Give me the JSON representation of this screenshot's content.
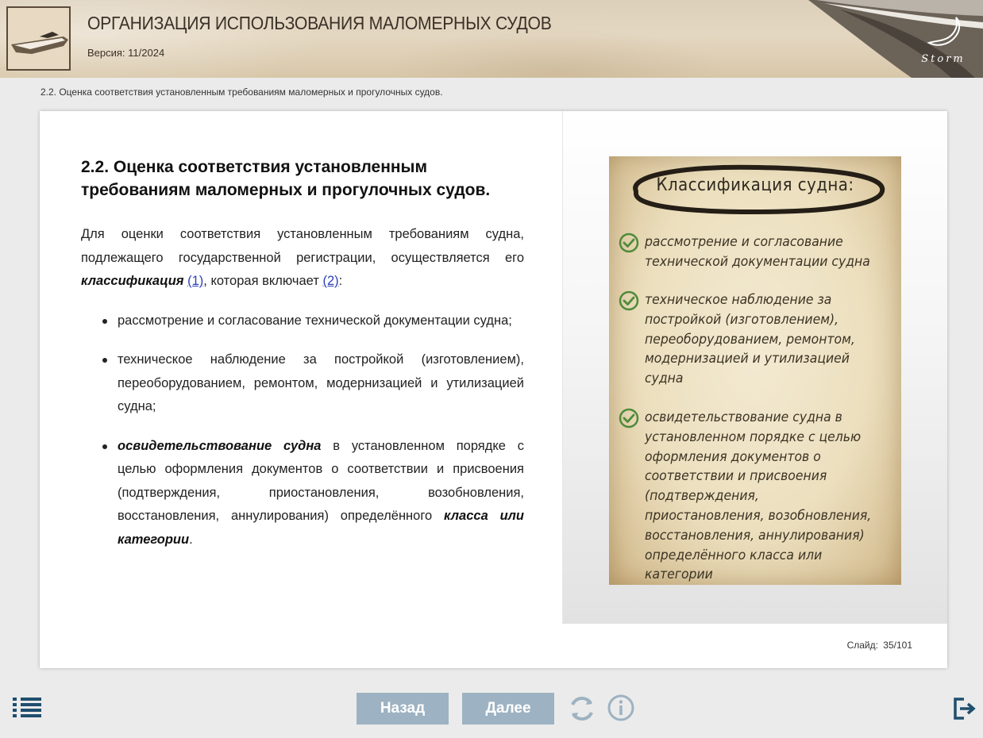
{
  "header": {
    "title": "ОРГАНИЗАЦИЯ ИСПОЛЬЗОВАНИЯ МАЛОМЕРНЫХ СУДОВ",
    "version": "Версия: 11/2024",
    "brand": "Storm"
  },
  "breadcrumb": "2.2. Оценка соответствия установленным требованиям маломерных и прогулочных судов.",
  "slide": {
    "title": "2.2. Оценка соответствия установленным требованиям маломерных и прогулочных судов.",
    "intro": {
      "text1": "Для оценки соответствия установленным требованиям судна, подлежащего государственной регистрации, осуществляется его ",
      "emphasis": "классификация",
      "link1": "(1)",
      "text2": ", которая включает ",
      "link2": "(2)",
      "text3": ":"
    },
    "bullets": [
      {
        "text": "рассмотрение и согласование технической документации судна;"
      },
      {
        "text": "техническое наблюдение за постройкой (изготовлением), переоборудованием, ремонтом, модернизацией и утилизацией судна;"
      },
      {
        "emphasis": "освидетельствование судна",
        "text": " в установленном порядке с целью оформления документов о соответствии и присвоения (подтверждения, приостановления, возобновления, восстановления, аннулирования) определённого ",
        "emphasis2": "класса или категории",
        "end": "."
      }
    ],
    "counter": "Слайд: 35/101"
  },
  "poster": {
    "heading": "Классификация судна:",
    "items": [
      "рассмотрение и согласование технической документации судна",
      "техническое наблюдение за постройкой (изготовлением), переоборудованием, ремонтом, модернизацией и утилизацией судна",
      "освидетельствование судна в установленном порядке с целью оформления документов о соответствии и присвоения (подтверждения, приостановления, возобновления, восстановления, аннулирования) определённого класса или категории"
    ]
  },
  "navigation": {
    "back_label": "Назад",
    "next_label": "Далее",
    "icons": {
      "menu": "menu-list-icon",
      "reload": "reload-icon",
      "info": "info-icon",
      "exit": "exit-icon"
    }
  },
  "colors": {
    "nav_button": "#9db2c2",
    "icon": "#1f4e6e",
    "icon_light": "#9db2c2",
    "link": "#2b3fb8",
    "check": "#4f8a3a"
  }
}
